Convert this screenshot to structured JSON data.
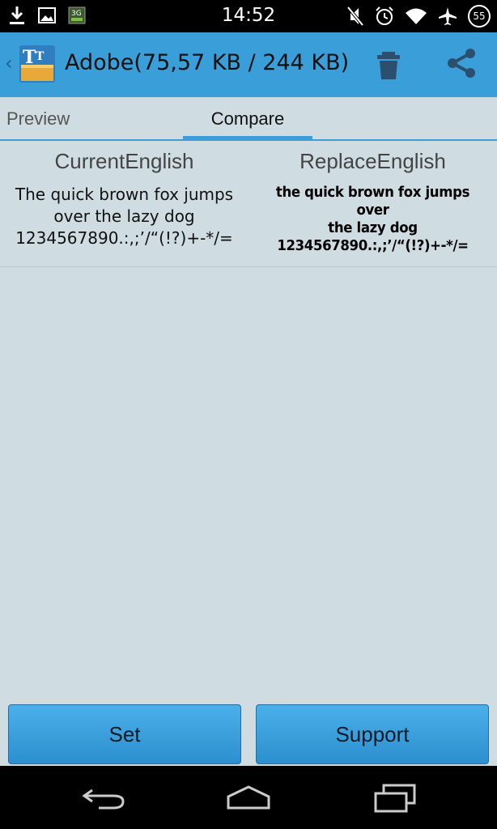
{
  "status_bar": {
    "time": "14:52",
    "battery": "55",
    "left_icons": [
      "download-icon",
      "image-icon",
      "3g-icon"
    ],
    "right_icons": [
      "mute-icon",
      "alarm-icon",
      "wifi-icon",
      "airplane-icon"
    ]
  },
  "action_bar": {
    "title": "Adobe(75,57 KB / 244 KB)",
    "back_glyph": "‹"
  },
  "tabs": [
    {
      "label": "Preview",
      "selected": false
    },
    {
      "label": "Compare",
      "selected": true
    }
  ],
  "compare": {
    "current": {
      "title": "CurrentEnglish",
      "sample_line1": "The quick brown fox jumps",
      "sample_line2": "over the lazy dog",
      "sample_line3": "1234567890.:,;’/“(!?)+-*/="
    },
    "replace": {
      "title": "ReplaceEnglish",
      "sample_line1": "the quick brown fox jumps over",
      "sample_line2": "the lazy dog",
      "sample_line3": "1234567890.:,;’/“(!?)+-*/="
    }
  },
  "buttons": {
    "set": "Set",
    "support": "Support"
  },
  "colors": {
    "accent": "#3a9ed9",
    "background": "#cfdde3"
  }
}
